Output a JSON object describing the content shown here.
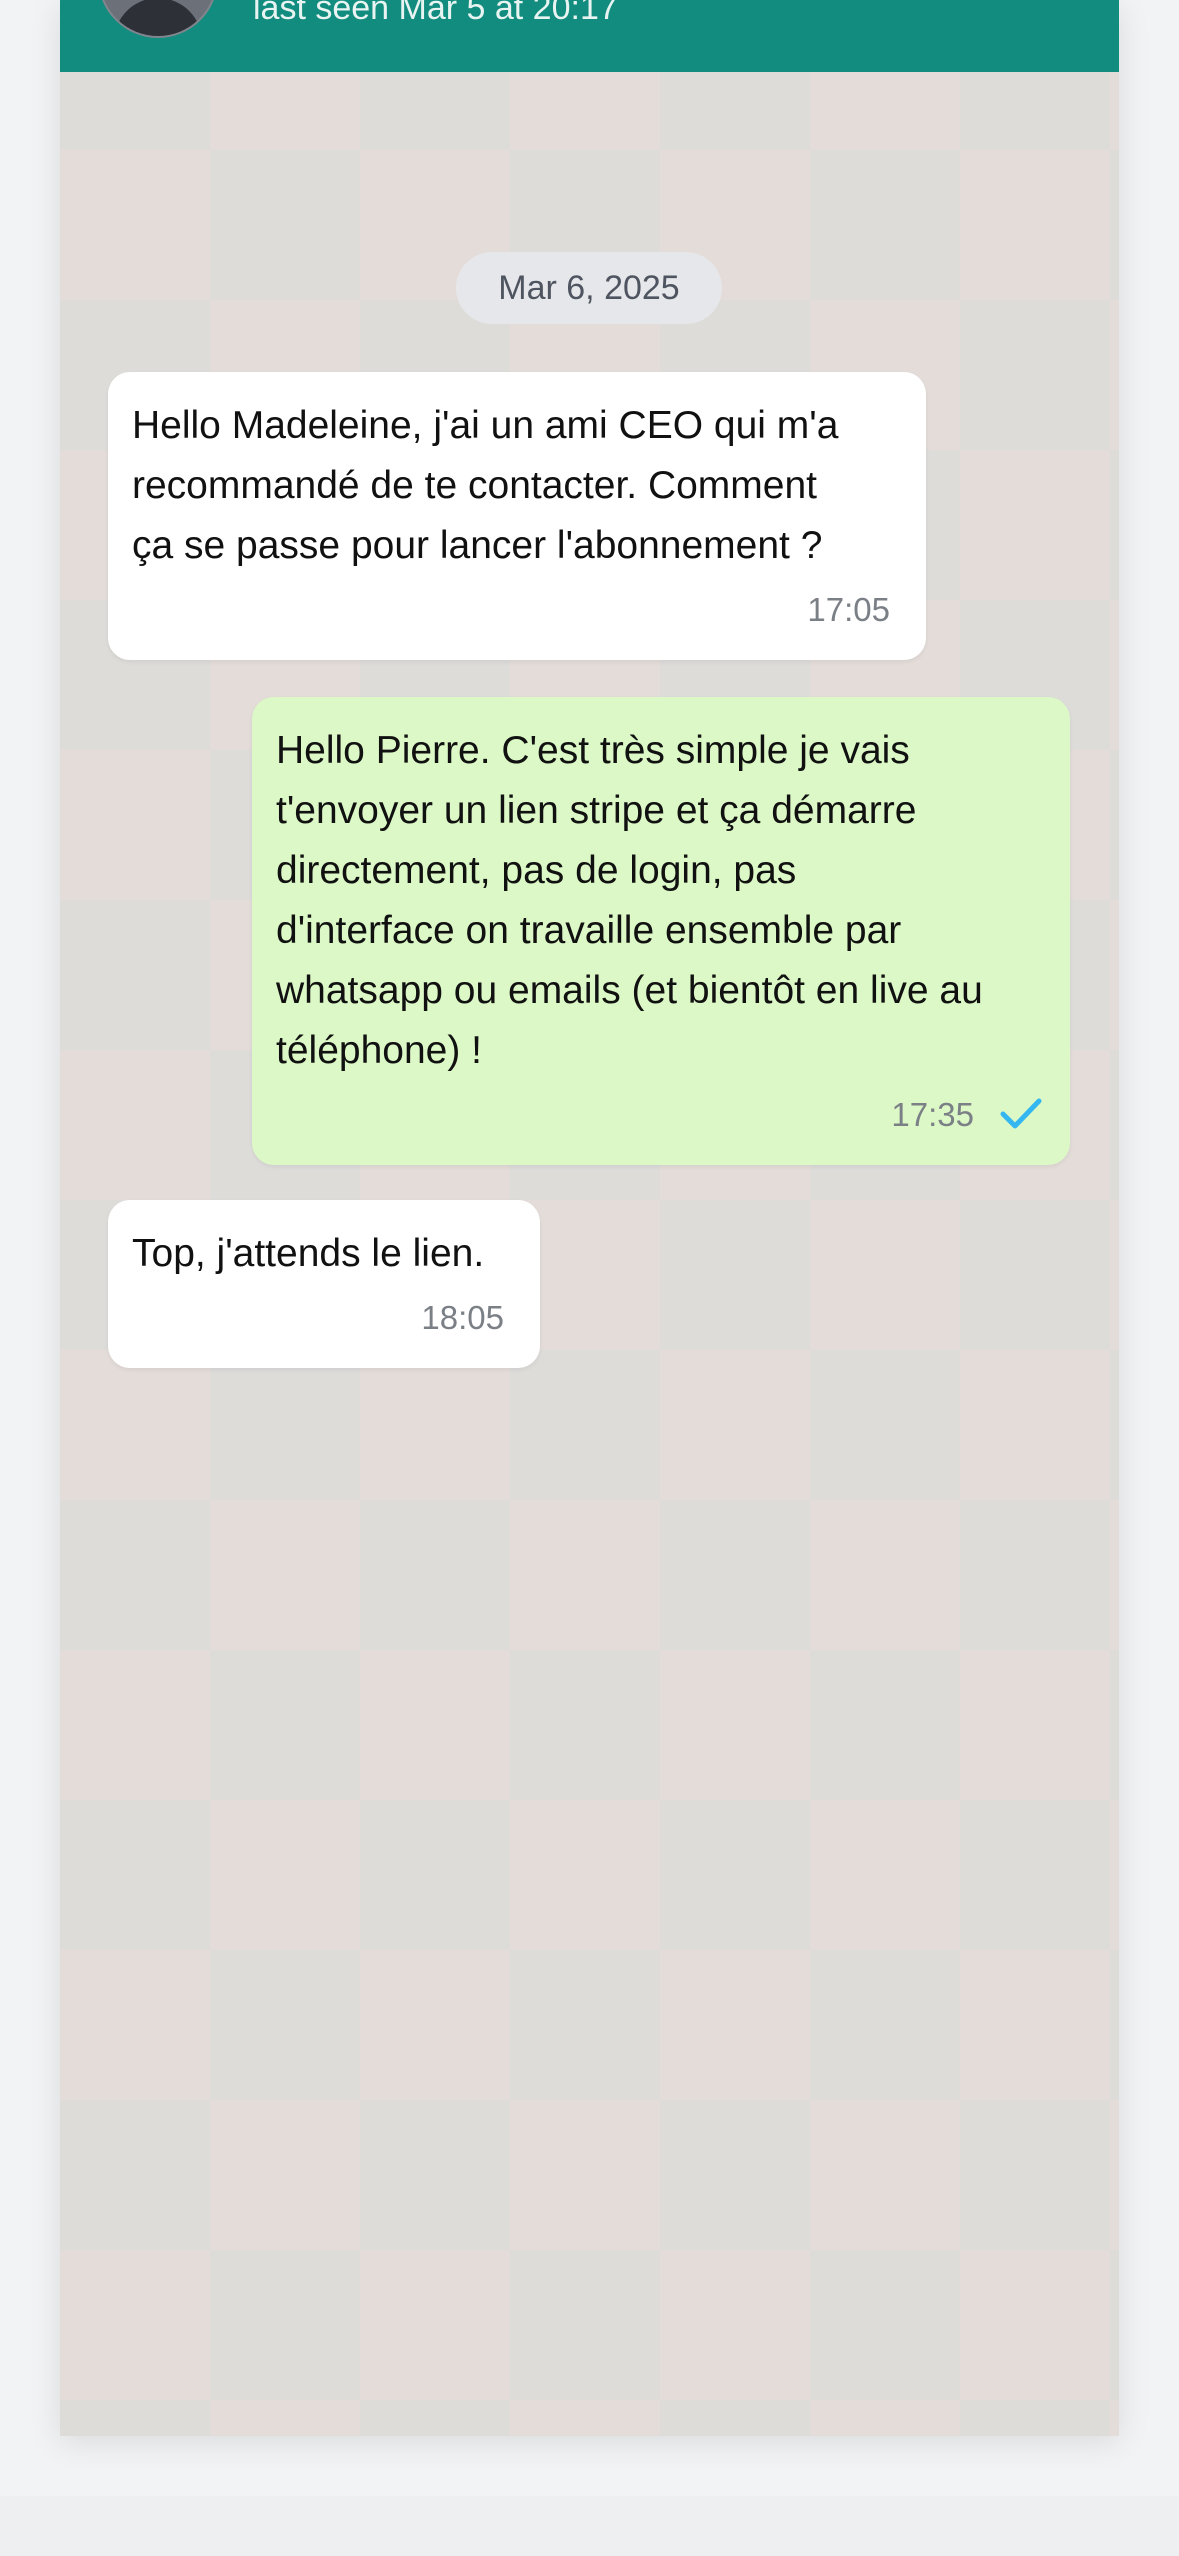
{
  "header": {
    "last_seen": "last seen Mar 5 at 20:17",
    "avatar_icon": "contact-avatar",
    "color": "#128c7e"
  },
  "chat": {
    "date_label": "Mar 6, 2025",
    "messages": [
      {
        "direction": "incoming",
        "lines": [
          "Hello Madeleine, j'ai un ami CEO qui m'a",
          "recommandé de te contacter. Comment",
          "ça se passe pour lancer l'abonnement ?"
        ],
        "time": "17:05"
      },
      {
        "direction": "outgoing",
        "lines": [
          "Hello Pierre. C'est très simple je vais",
          "t'envoyer un lien stripe et ça démarre",
          "directement, pas de login, pas",
          "d'interface on travaille ensemble par",
          "whatsapp ou emails (et bientôt en live au",
          "téléphone) !"
        ],
        "time": "17:35",
        "status_icon": "single-check-icon"
      },
      {
        "direction": "incoming",
        "lines": [
          "Top, j'attends le lien."
        ],
        "time": "18:05"
      }
    ]
  },
  "colors": {
    "incoming_bubble": "#ffffff",
    "outgoing_bubble": "#dbf8c6",
    "check": "#34b7f1"
  }
}
